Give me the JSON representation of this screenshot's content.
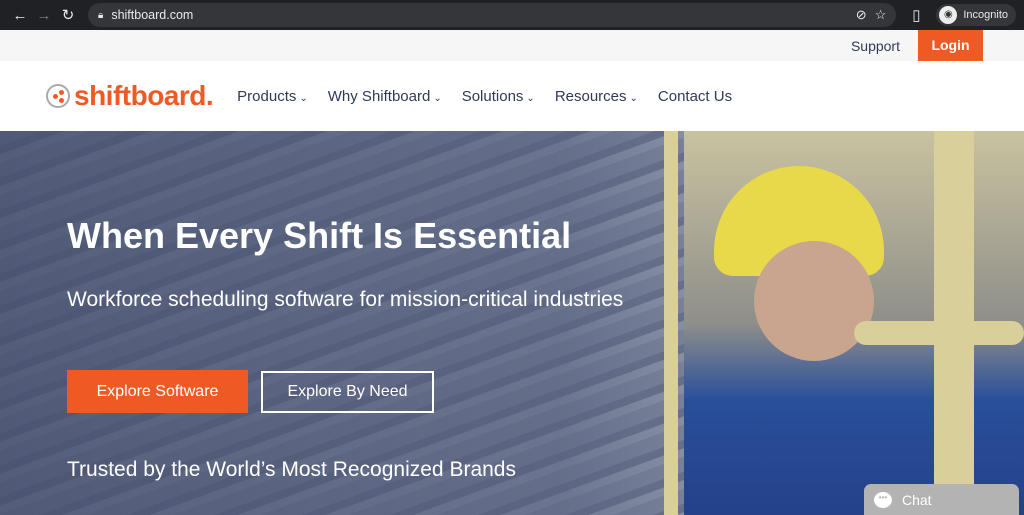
{
  "browser": {
    "url": "shiftboard.com",
    "profile": "Incognito"
  },
  "topbar": {
    "support": "Support",
    "login": "Login"
  },
  "logo": {
    "text": "shiftboard."
  },
  "nav": [
    "Products",
    "Why Shiftboard",
    "Solutions",
    "Resources",
    "Contact Us"
  ],
  "hero": {
    "title": "When Every Shift Is Essential",
    "subtitle": "Workforce scheduling software for mission-critical industries",
    "btn_primary": "Explore Software",
    "btn_secondary": "Explore By Need",
    "trusted": "Trusted by the World’s Most Recognized Brands"
  },
  "chat": {
    "label": "Chat"
  },
  "colors": {
    "brand": "#ef5a24",
    "text": "#2e3b55"
  }
}
